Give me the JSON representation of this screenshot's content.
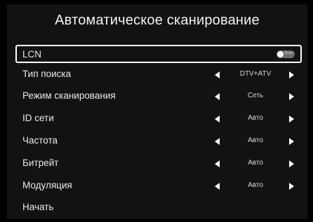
{
  "title": "Автоматическое сканирование",
  "lcn": {
    "label": "LCN",
    "toggle_text": "Выкл"
  },
  "options": [
    {
      "label": "Тип поиска",
      "value": "DTV+ATV"
    },
    {
      "label": "Режим сканирования",
      "value": "Сеть"
    },
    {
      "label": "ID сети",
      "value": "Авто"
    },
    {
      "label": "Частота",
      "value": "Авто"
    },
    {
      "label": "Битрейт",
      "value": "Авто"
    },
    {
      "label": "Модуляция",
      "value": "Авто"
    }
  ],
  "start": {
    "label": "Начать"
  },
  "icons": {
    "left": "triangle-left-icon",
    "right": "triangle-right-icon"
  }
}
